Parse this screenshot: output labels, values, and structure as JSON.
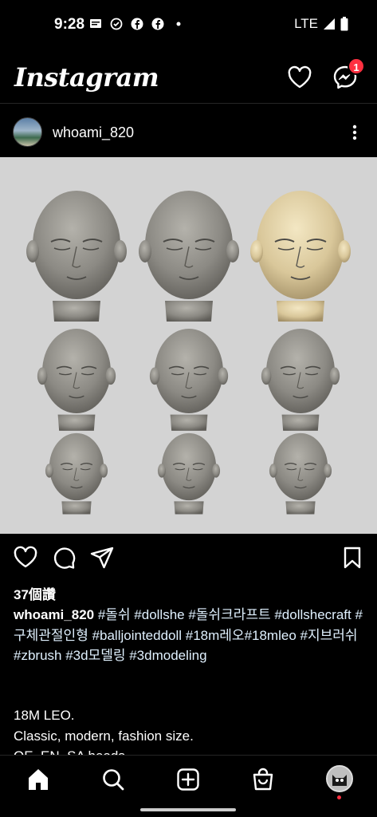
{
  "status_bar": {
    "time": "9:28",
    "network": "LTE",
    "left_icons": [
      "sms-icon",
      "check-circle-icon",
      "facebook-icon",
      "facebook-icon",
      "dot-icon"
    ]
  },
  "header": {
    "logo": "Instagram",
    "messages_badge": "1"
  },
  "post": {
    "username": "whoami_820",
    "image_alt": "3D sculpted doll head models in a 3x3 grid",
    "likes": "37個讚",
    "caption_user": "whoami_820",
    "caption_tags_line": " #돌쉬 #dollshe #돌쉬크라프트 #dollshecraft #구체관절인형 #balljointeddoll #18m레오#18mleo #지브러쉬 #zbrush #3d모델링 #3dmodeling",
    "body_lines": [
      "18M LEO.",
      "Classic, modern, fashion size.",
      "OE, EN, SA heads"
    ]
  },
  "colors": {
    "background": "#000000",
    "badge": "#ff3040",
    "post_bg": "#d3d3d3",
    "head_gray": "#8c8a84",
    "head_tan": "#d9c79a"
  },
  "nav": {
    "items": [
      "home-icon",
      "search-icon",
      "create-icon",
      "shop-icon",
      "profile-avatar"
    ]
  }
}
